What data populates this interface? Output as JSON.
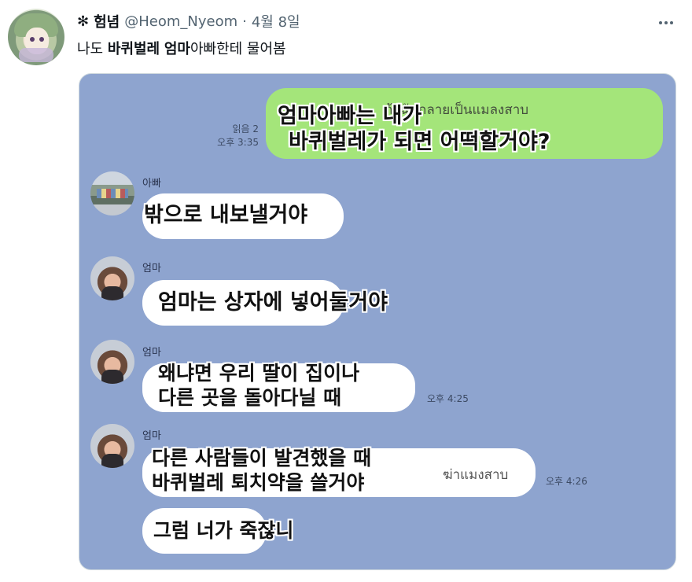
{
  "tweet": {
    "flower_glyph": "✻",
    "display_name": "험념",
    "handle": "@Heom_Nyeom",
    "separator": "·",
    "date": "4월 8일",
    "text_prefix": "나도 ",
    "text_bold_1": "바퀴벌레",
    "text_mid": " ",
    "text_bold_2": "엄마",
    "text_suffix": "아빠한테 물어봄",
    "more_icon": "more-icon"
  },
  "chat": {
    "background_color": "#8ea4cf",
    "outgoing": {
      "thai_text": "ถ้าฉันกลายเป็นแมลงสาบ",
      "caption_line1": "엄마아빠는 내가",
      "caption_line2": "바퀴벌레가 되면 어떡할거야?",
      "read_label": "읽음 2",
      "time": "오후 3:35"
    },
    "dad": {
      "sender": "아빠",
      "caption": "밖으로 내보낼거야"
    },
    "mom1": {
      "sender": "엄마",
      "caption": "엄마는 상자에 넣어둘거야"
    },
    "mom2": {
      "sender": "엄마",
      "caption_line1": "왜냐면 우리 딸이 집이나",
      "caption_line2": "다른 곳을 돌아다닐 때",
      "time": "오후 4:25"
    },
    "mom3": {
      "sender": "엄마",
      "thai_text": "ฆ่าแมงสาบ",
      "caption_line1": "다른 사람들이 발견했을 때",
      "caption_line2": "바퀴벌레 퇴치약을 쓸거야",
      "time": "오후 4:26",
      "caption2": "그럼 너가 죽잖니"
    }
  }
}
